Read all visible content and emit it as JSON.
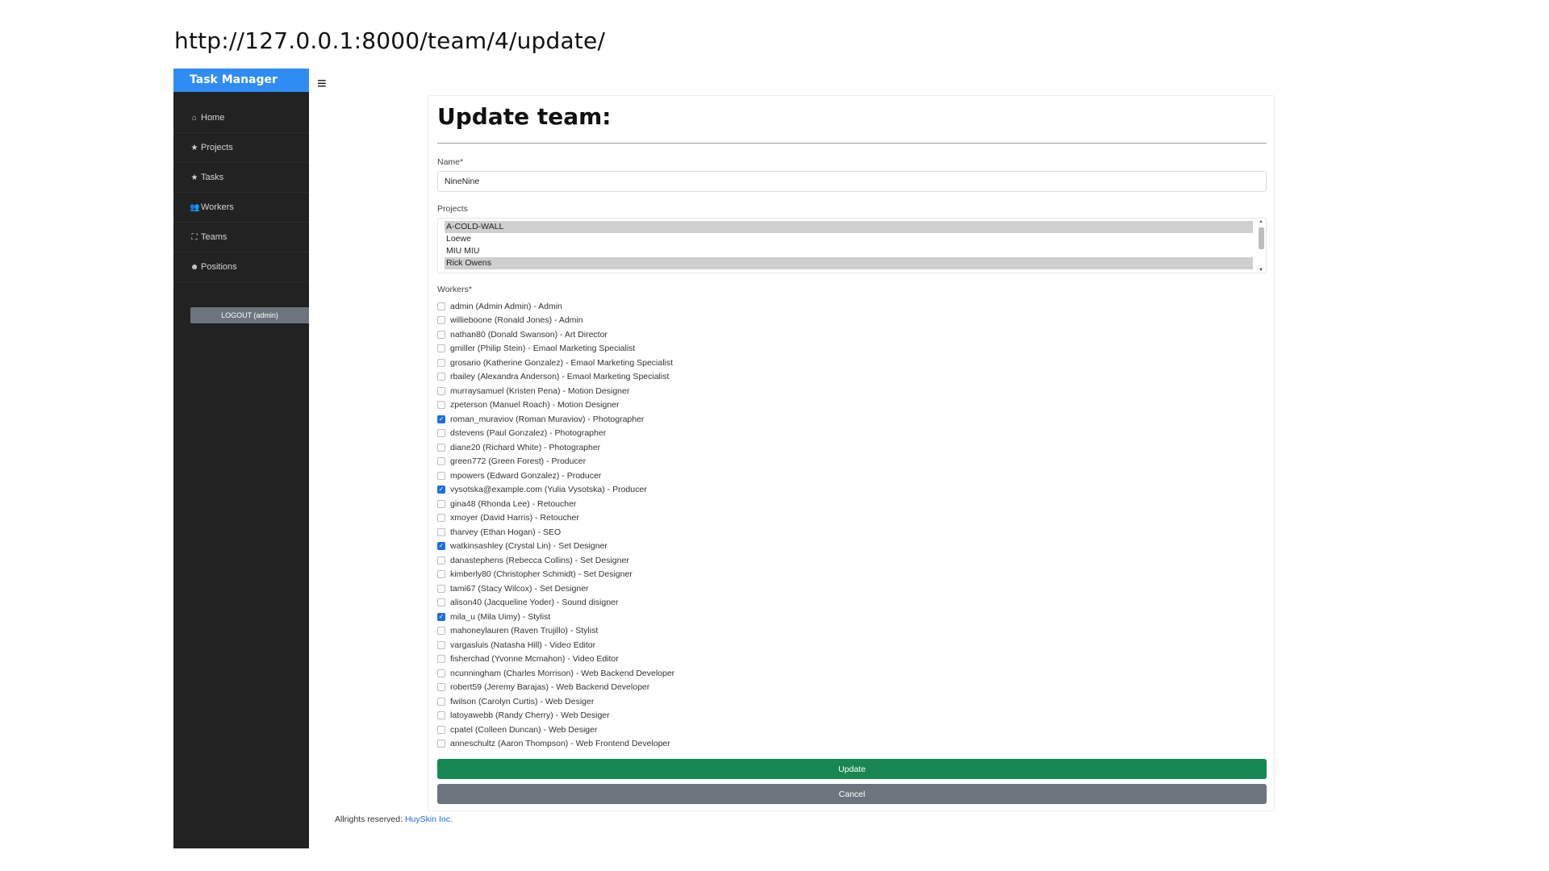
{
  "url": "http://127.0.0.1:8000/team/4/update/",
  "sidebar": {
    "brand": "Task Manager",
    "items": [
      {
        "icon": "home-icon",
        "glyph": "⌂",
        "label": "Home"
      },
      {
        "icon": "star-icon",
        "glyph": "★",
        "label": "Projects"
      },
      {
        "icon": "star-icon",
        "glyph": "★",
        "label": "Tasks"
      },
      {
        "icon": "users-icon",
        "glyph": "👥",
        "label": "Workers"
      },
      {
        "icon": "sitemap-icon",
        "glyph": "⛶",
        "label": "Teams"
      },
      {
        "icon": "face-icon",
        "glyph": "☻",
        "label": "Positions"
      }
    ],
    "logout_label": "LOGOUT (admin)"
  },
  "menu_icon": "hamburger-icon",
  "form": {
    "title": "Update team:",
    "name_label": "Name*",
    "name_value": "NineNine",
    "projects_label": "Projects",
    "projects": [
      {
        "label": "A-COLD-WALL",
        "selected": true
      },
      {
        "label": "Loewe",
        "selected": false
      },
      {
        "label": "MIU MIU",
        "selected": false
      },
      {
        "label": "Rick Owens",
        "selected": true
      }
    ],
    "workers_label": "Workers*",
    "workers": [
      {
        "label": "admin (Admin Admin) - Admin",
        "checked": false
      },
      {
        "label": "willieboone (Ronald Jones) - Admin",
        "checked": false
      },
      {
        "label": "nathan80 (Donald Swanson) - Art Director",
        "checked": false
      },
      {
        "label": "gmiller (Philip Stein) - Emaol Marketing Specialist",
        "checked": false
      },
      {
        "label": "grosario (Katherine Gonzalez) - Emaol Marketing Specialist",
        "checked": false
      },
      {
        "label": "rbailey (Alexandra Anderson) - Emaol Marketing Specialist",
        "checked": false
      },
      {
        "label": "murraysamuel (Kristen Pena) - Motion Designer",
        "checked": false
      },
      {
        "label": "zpeterson (Manuel Roach) - Motion Designer",
        "checked": false
      },
      {
        "label": "roman_muraviov (Roman Muraviov) - Photographer",
        "checked": true
      },
      {
        "label": "dstevens (Paul Gonzalez) - Photographer",
        "checked": false
      },
      {
        "label": "diane20 (Richard White) - Photographer",
        "checked": false
      },
      {
        "label": "green772 (Green Forest) - Producer",
        "checked": false
      },
      {
        "label": "mpowers (Edward Gonzalez) - Producer",
        "checked": false
      },
      {
        "label": "vysotska@example.com (Yulia Vysotska) - Producer",
        "checked": true
      },
      {
        "label": "gina48 (Rhonda Lee) - Retoucher",
        "checked": false
      },
      {
        "label": "xmoyer (David Harris) - Retoucher",
        "checked": false
      },
      {
        "label": "tharvey (Ethan Hogan) - SEO",
        "checked": false
      },
      {
        "label": "watkinsashley (Crystal Lin) - Set Designer",
        "checked": true
      },
      {
        "label": "danastephens (Rebecca Collins) - Set Designer",
        "checked": false
      },
      {
        "label": "kimberly80 (Christopher Schmidt) - Set Designer",
        "checked": false
      },
      {
        "label": "tami67 (Stacy Wilcox) - Set Designer",
        "checked": false
      },
      {
        "label": "alison40 (Jacqueline Yoder) - Sound disigner",
        "checked": false
      },
      {
        "label": "mila_u (Mila Uimy) - Stylist",
        "checked": true
      },
      {
        "label": "mahoneylauren (Raven Trujillo) - Stylist",
        "checked": false
      },
      {
        "label": "vargasluis (Natasha Hill) - Video Editor",
        "checked": false
      },
      {
        "label": "fisherchad (Yvonne Mcmahon) - Video Editor",
        "checked": false
      },
      {
        "label": "ncunningham (Charles Morrison) - Web Backend Developer",
        "checked": false
      },
      {
        "label": "robert59 (Jeremy Barajas) - Web Backend Developer",
        "checked": false
      },
      {
        "label": "fwilson (Carolyn Curtis) - Web Desiger",
        "checked": false
      },
      {
        "label": "latoyawebb (Randy Cherry) - Web Desiger",
        "checked": false
      },
      {
        "label": "cpatel (Colleen Duncan) - Web Desiger",
        "checked": false
      },
      {
        "label": "anneschultz (Aaron Thompson) - Web Frontend Developer",
        "checked": false
      }
    ],
    "update_label": "Update",
    "cancel_label": "Cancel"
  },
  "footer": {
    "text": "Allrights reserved:",
    "link": "HuySkin Inc."
  },
  "colors": {
    "brand": "#2f8cf5",
    "sidebar": "#222222",
    "update": "#198754",
    "cancel": "#6c757d",
    "checked": "#1a6fe0",
    "link": "#1a6fe0"
  }
}
